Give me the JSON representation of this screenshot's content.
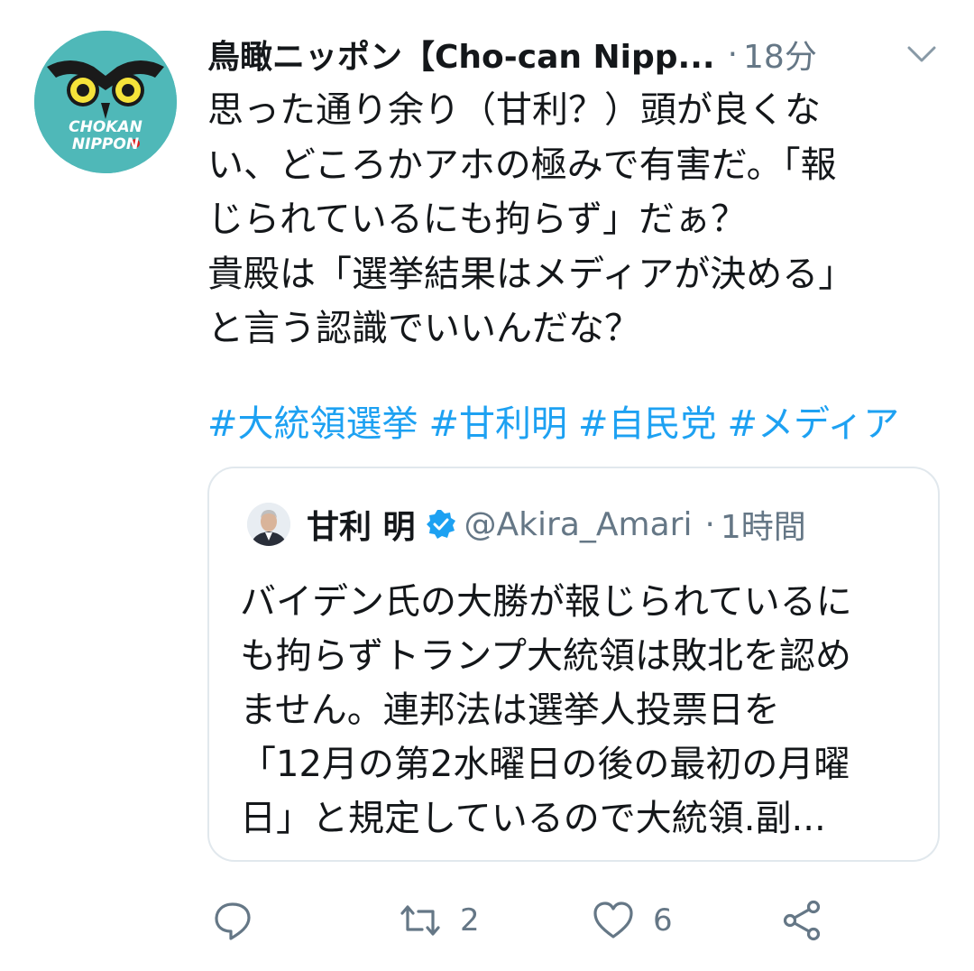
{
  "tweet": {
    "author_name": "鳥瞰ニッポン【Cho-can Nipp...",
    "separator": "·",
    "time": "18分",
    "text": "思った通り余り（甘利？）頭が良くな\nい、どころかアホの極みで有害だ。「報\nじられているにも拘らず」だぁ？\n貴殿は「選挙結果はメディアが決める」\nと言う認識でいいんだな？",
    "hashtags": [
      "#大統領選挙",
      "#甘利明",
      "#自民党",
      "#メディア"
    ]
  },
  "avatar": {
    "text_line1": "CHOKAN",
    "text_line2": "NIPPON",
    "bg_color": "#4fb8b8"
  },
  "quoted": {
    "name": "甘利 明",
    "handle": "@Akira_Amari",
    "separator": "·",
    "time": "1時間",
    "text": "バイデン氏の大勝が報じられているに\nも拘らずトランプ大統領は敗北を認め\nません。連邦法は選挙人投票日を\n「12月の第2水曜日の後の最初の月曜\n日」と規定しているので大統領.副..."
  },
  "actions": {
    "reply_icon": "reply-icon",
    "retweet_icon": "retweet-icon",
    "retweet_count": "2",
    "like_icon": "heart-icon",
    "like_count": "6",
    "share_icon": "share-icon"
  },
  "colors": {
    "link": "#1da1f2",
    "secondary_text": "#657786",
    "verified": "#1da1f2",
    "border": "#e1e8ed"
  }
}
